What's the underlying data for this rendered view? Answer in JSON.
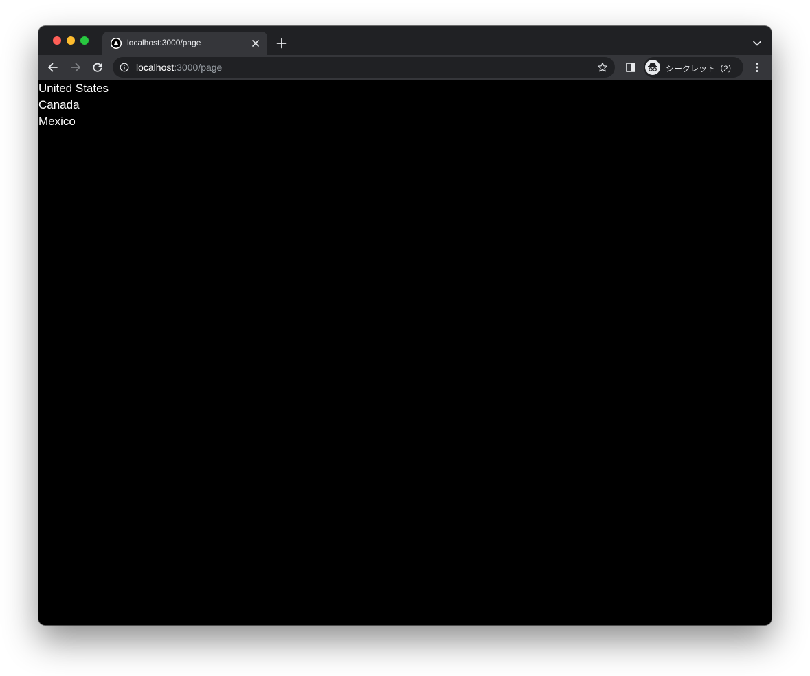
{
  "browser": {
    "tab": {
      "title": "localhost:3000/page"
    },
    "address_bar": {
      "host": "localhost",
      "path": ":3000/page"
    },
    "profile": {
      "label": "シークレット（2）"
    }
  },
  "page": {
    "countries": [
      "United States",
      "Canada",
      "Mexico"
    ]
  },
  "colors": {
    "tabstrip_bg": "#202124",
    "toolbar_bg": "#35363a",
    "page_bg": "#000000",
    "text": "#ffffff"
  },
  "icons": {
    "favicon": "nextjs-triangle-icon",
    "tab_close": "close-icon",
    "new_tab": "plus-icon",
    "tab_search": "chevron-down-icon",
    "back": "arrow-left-icon",
    "forward": "arrow-right-icon",
    "reload": "reload-icon",
    "site_info": "info-icon",
    "bookmark": "star-icon",
    "side_panel": "side-panel-icon",
    "incognito": "incognito-icon",
    "menu": "more-vert-icon"
  }
}
